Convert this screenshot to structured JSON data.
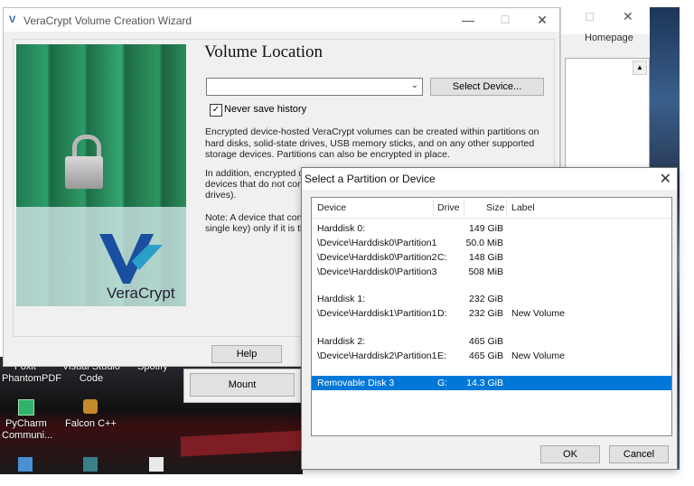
{
  "desktop": {
    "icons": [
      {
        "label_line1": "Foxit",
        "label_line2": "PhantomPDF"
      },
      {
        "label_line1": "Visual Studio",
        "label_line2": "Code"
      },
      {
        "label_line1": "Spotify",
        "label_line2": ""
      },
      {
        "label_line1": "PyCharm",
        "label_line2": "Communi..."
      },
      {
        "label_line1": "Falcon C++",
        "label_line2": ""
      }
    ]
  },
  "background_window": {
    "title": "Homepage",
    "minimize": "☐",
    "close": "✕",
    "scroll_up": "▲"
  },
  "wizard": {
    "title": "VeraCrypt Volume Creation Wizard",
    "logo_glyph": "V",
    "minimize": "—",
    "maximize": "☐",
    "close": "✕",
    "image_brand": "VeraCrypt",
    "heading": "Volume Location",
    "combo_value": "",
    "combo_arrow": "⌄",
    "select_device_label": "Select Device...",
    "never_save_history_checked": true,
    "never_save_history_label": "Never save history",
    "checkmark": "✓",
    "para1": "Encrypted device-hosted VeraCrypt volumes can be created within partitions on hard disks, solid-state drives, USB memory sticks, and on any other supported storage devices. Partitions can also be encrypted in place.",
    "para2_visible": "In addition, encrypted d",
    "para2_line2": "devices that do not cont",
    "para2_line3": "drives).",
    "para3_line1": "Note: A device that cont",
    "para3_line2": "single key) only if it is th",
    "help_label": "Help",
    "mount_label": "Mount"
  },
  "dialog": {
    "title": "Select a Partition or Device",
    "close": "✕",
    "columns": {
      "device": "Device",
      "drive": "Drive",
      "size": "Size",
      "label": "Label"
    },
    "rows": [
      {
        "device": "Harddisk 0:",
        "drive": "",
        "size": "149 GiB",
        "label": "",
        "selected": false
      },
      {
        "device": "\\Device\\Harddisk0\\Partition1",
        "drive": "",
        "size": "50.0 MiB",
        "label": "",
        "selected": false
      },
      {
        "device": "\\Device\\Harddisk0\\Partition2",
        "drive": "C:",
        "size": "148 GiB",
        "label": "",
        "selected": false
      },
      {
        "device": "\\Device\\Harddisk0\\Partition3",
        "drive": "",
        "size": "508 MiB",
        "label": "",
        "selected": false
      },
      {
        "device": "Harddisk 1:",
        "drive": "",
        "size": "232 GiB",
        "label": "",
        "selected": false
      },
      {
        "device": "\\Device\\Harddisk1\\Partition1",
        "drive": "D:",
        "size": "232 GiB",
        "label": "New Volume",
        "selected": false
      },
      {
        "device": "Harddisk 2:",
        "drive": "",
        "size": "465 GiB",
        "label": "",
        "selected": false
      },
      {
        "device": "\\Device\\Harddisk2\\Partition1",
        "drive": "E:",
        "size": "465 GiB",
        "label": "New Volume",
        "selected": false
      },
      {
        "device": "Removable Disk 3",
        "drive": "G:",
        "size": "14.3 GiB",
        "label": "",
        "selected": true
      }
    ],
    "ok_label": "OK",
    "cancel_label": "Cancel"
  },
  "colors": {
    "selection": "#0078d7",
    "window_bg": "#f0f0f0",
    "button_bg": "#e1e1e1"
  }
}
